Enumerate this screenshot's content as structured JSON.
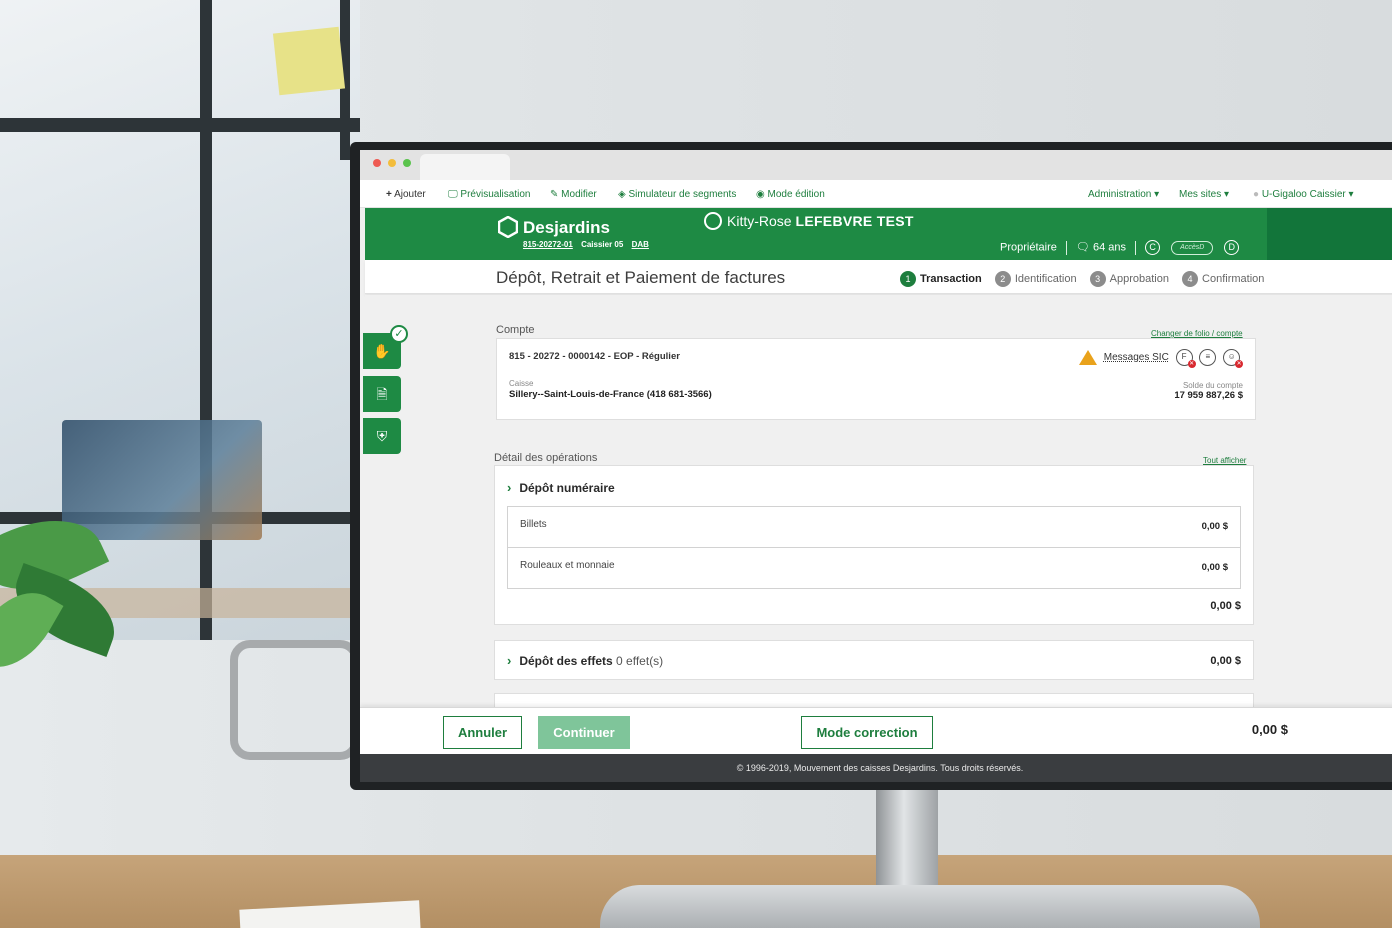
{
  "toolbar": {
    "add": "Ajouter",
    "preview": "Prévisualisation",
    "modify": "Modifier",
    "simulator": "Simulateur de segments",
    "edit_mode": "Mode édition",
    "admin": "Administration",
    "sites": "Mes sites",
    "user": "U-Gigaloo Caissier"
  },
  "header": {
    "brand": "Desjardins",
    "branch_code": "815-20272-01",
    "teller": "Caissier 05",
    "dab": "DAB",
    "client_first": "Kitty-Rose",
    "client_last": "LEFEBVRE TEST",
    "role": "Propriétaire",
    "age": "64 ans",
    "c_icon": "C",
    "accesd": "AccèsD",
    "d_icon": "D"
  },
  "page": {
    "title": "Dépôt, Retrait et Paiement de factures",
    "steps": [
      {
        "num": "1",
        "label": "Transaction"
      },
      {
        "num": "2",
        "label": "Identification"
      },
      {
        "num": "3",
        "label": "Approbation"
      },
      {
        "num": "4",
        "label": "Confirmation"
      }
    ]
  },
  "account": {
    "section_label": "Compte",
    "change_link": "Changer de folio / compte",
    "account_line": "815 - 20272 - 0000142 - EOP - Régulier",
    "sic_label": "Messages SIC",
    "caisse_label": "Caisse",
    "caisse_value": "Sillery--Saint-Louis-de-France (418 681-3566)",
    "balance_label": "Solde du compte",
    "balance_value": "17 959 887,26 $"
  },
  "operations": {
    "section_label": "Détail des opérations",
    "show_all": "Tout afficher",
    "cash_deposit": {
      "title": "Dépôt numéraire",
      "rows": [
        {
          "label": "Billets",
          "value": "0,00 $"
        },
        {
          "label": "Rouleaux et monnaie",
          "value": "0,00 $"
        }
      ],
      "total": "0,00 $"
    },
    "cheque_deposit": {
      "title": "Dépôt des effets",
      "count": "0 effet(s)",
      "total": "0,00 $"
    }
  },
  "actions": {
    "cancel": "Annuler",
    "continue": "Continuer",
    "correction": "Mode correction",
    "total": "0,00 $"
  },
  "footer": {
    "copyright": "© 1996-2019, Mouvement des caisses Desjardins. Tous droits réservés."
  },
  "colors": {
    "brand_green": "#1e8a44",
    "link_green": "#1e7e3e",
    "disabled_green": "#7fc59a",
    "warning": "#e9a21b"
  }
}
